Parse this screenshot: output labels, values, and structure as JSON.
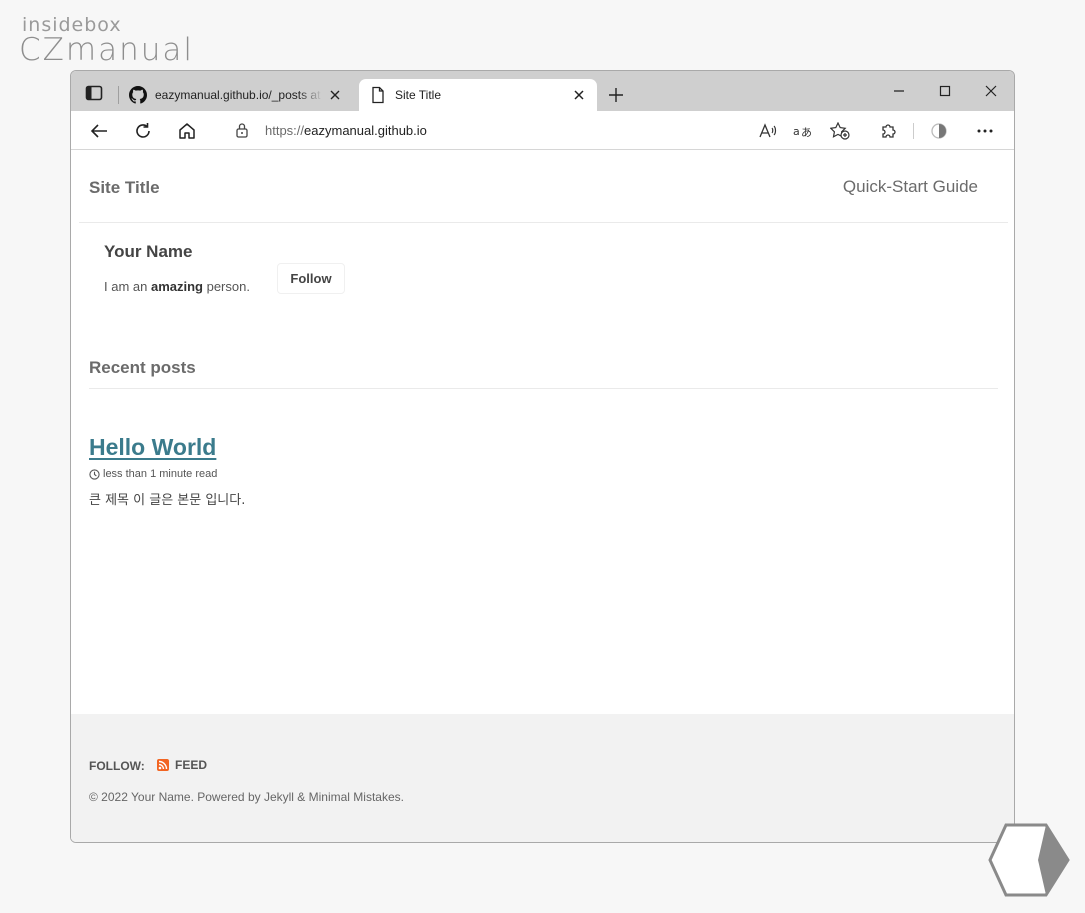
{
  "watermark": {
    "line1": "insidebox",
    "line2": "CZmanual"
  },
  "browser": {
    "tabs": [
      {
        "label": "eazymanual.github.io/_posts at m",
        "icon": "github-icon",
        "active": false
      },
      {
        "label": "Site Title",
        "icon": "page-icon",
        "active": true
      }
    ],
    "address": {
      "scheme": "https://",
      "host": "eazymanual.github.io"
    }
  },
  "site": {
    "title": "Site Title",
    "nav": [
      "Quick-Start Guide"
    ]
  },
  "author": {
    "name": "Your Name",
    "bio_prefix": "I am an ",
    "bio_bold": "amazing",
    "bio_suffix": " person.",
    "follow_label": "Follow"
  },
  "recent": {
    "heading": "Recent posts",
    "posts": [
      {
        "title": "Hello World",
        "read_time": "less than 1 minute read",
        "excerpt": "큰 제목 이 글은 본문 입니다."
      }
    ]
  },
  "footer": {
    "follow_label": "FOLLOW:",
    "feed_label": "FEED",
    "copyright": "© 2022 Your Name. Powered by Jekyll & Minimal Mistakes."
  },
  "colors": {
    "link": "#3b7b8c",
    "rss": "#f26522",
    "footer_bg": "#f2f2f2"
  }
}
